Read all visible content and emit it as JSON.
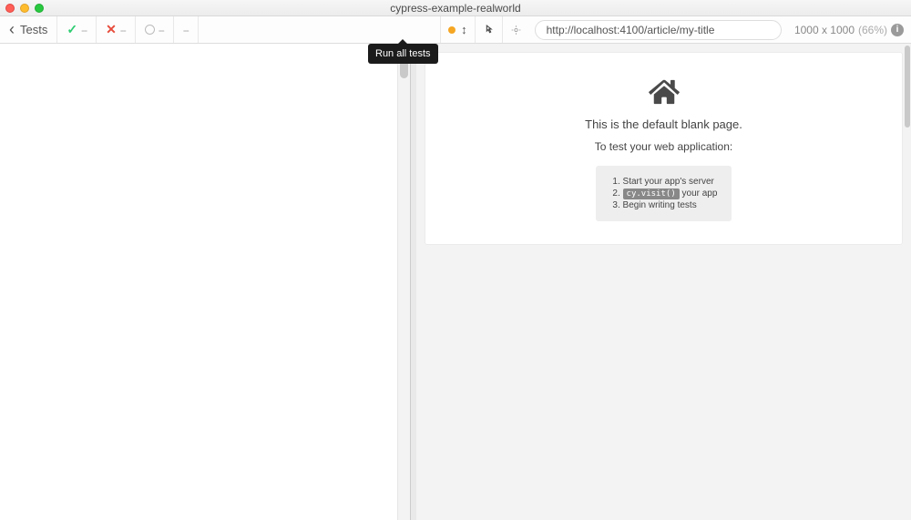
{
  "window": {
    "title": "cypress-example-realworld"
  },
  "toolbar": {
    "back_label": "Tests",
    "passed": "--",
    "failed": "--",
    "pending": "--",
    "skipped": "--",
    "run_tooltip": "Run all tests",
    "url": "http://localhost:4100/article/my-title",
    "viewport": "1000 x 1000",
    "scale": "(66%)"
  },
  "preview": {
    "line1": "This is the default blank page.",
    "line2": "To test your web application:",
    "steps": {
      "s1": "Start your app's server",
      "s2_code": "cy.visit()",
      "s2_rest": " your app",
      "s3": "Begin writing tests"
    }
  }
}
